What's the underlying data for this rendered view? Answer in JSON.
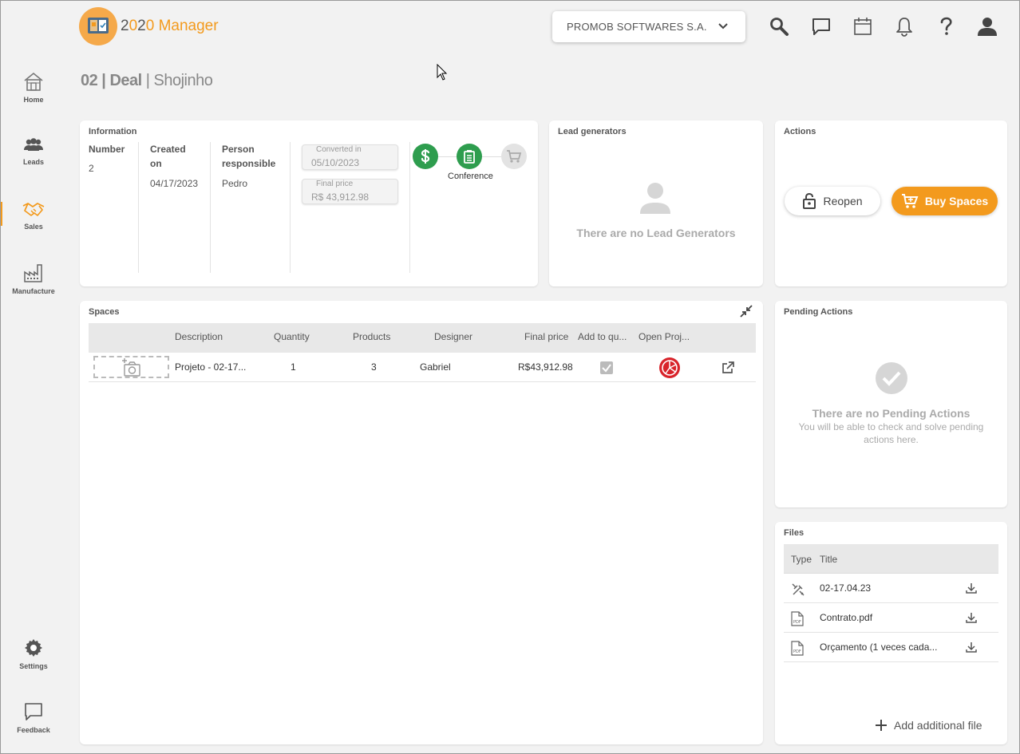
{
  "app": {
    "logo_text_a": "2",
    "logo_text_b": "0",
    "logo_text_c": "2",
    "logo_text_d": "0",
    "logo_text_e": " Manager"
  },
  "colors": {
    "accent": "#f39a1d",
    "green": "#2e9d4e",
    "grey_icon": "#d6d6d6",
    "table_header": "#e8e8e8"
  },
  "sidebar": {
    "items": [
      {
        "label": "Home",
        "icon": "home-icon",
        "active": false
      },
      {
        "label": "Leads",
        "icon": "people-icon",
        "active": false
      },
      {
        "label": "Sales",
        "icon": "handshake-icon",
        "active": true
      },
      {
        "label": "Manufacture",
        "icon": "factory-icon",
        "active": false
      }
    ],
    "bottom": [
      {
        "label": "Settings",
        "icon": "gear-icon"
      },
      {
        "label": "Feedback",
        "icon": "chat-icon"
      }
    ]
  },
  "header": {
    "company": "PROMOB SOFTWARES S.A.",
    "icons": [
      "search-icon",
      "message-icon",
      "calendar-icon",
      "bell-icon",
      "help-icon",
      "user-icon"
    ]
  },
  "page": {
    "id": "02 | Deal",
    "separator": "|",
    "name": "Shojinho"
  },
  "information": {
    "title": "Information",
    "number_label": "Number",
    "number": "2",
    "created_label_1": "Created",
    "created_label_2": "on",
    "created": "04/17/2023",
    "person_label_1": "Person",
    "person_label_2": "responsible",
    "person": "Pedro",
    "converted_label": "Converted in",
    "converted": "05/10/2023",
    "final_price_label": "Final price",
    "final_price": "R$ 43,912.98",
    "steps": [
      {
        "icon": "dollar-icon",
        "state": "done"
      },
      {
        "icon": "clipboard-icon",
        "state": "done",
        "label": "Conference"
      },
      {
        "icon": "cart-icon",
        "state": "pending"
      }
    ]
  },
  "lead_generators": {
    "title": "Lead generators",
    "empty": "There are no Lead Generators"
  },
  "actions": {
    "title": "Actions",
    "reopen": "Reopen",
    "buy": "Buy Spaces"
  },
  "spaces": {
    "title": "Spaces",
    "columns": [
      "Description",
      "Quantity",
      "Products",
      "Designer",
      "Final price",
      "Add to qu...",
      "Open Proj..."
    ],
    "rows": [
      {
        "description": "Projeto - 02-17...",
        "quantity": "1",
        "products": "3",
        "designer": "Gabriel",
        "final_price": "R$43,912.98",
        "add_to_quote": true
      }
    ]
  },
  "pending": {
    "title": "Pending Actions",
    "empty_title": "There are no Pending Actions",
    "empty_sub_1": "You will be able to check and solve pending",
    "empty_sub_2": "actions here."
  },
  "files": {
    "title": "Files",
    "col_type": "Type",
    "col_title": "Title",
    "rows": [
      {
        "icon": "design-tools-icon",
        "title": "02-17.04.23"
      },
      {
        "icon": "pdf-icon",
        "title": "Contrato.pdf",
        "badge": "PDF"
      },
      {
        "icon": "pdf-icon",
        "title": "Orçamento (1 veces cada...",
        "badge": "PDF"
      }
    ],
    "add": "Add additional file"
  }
}
